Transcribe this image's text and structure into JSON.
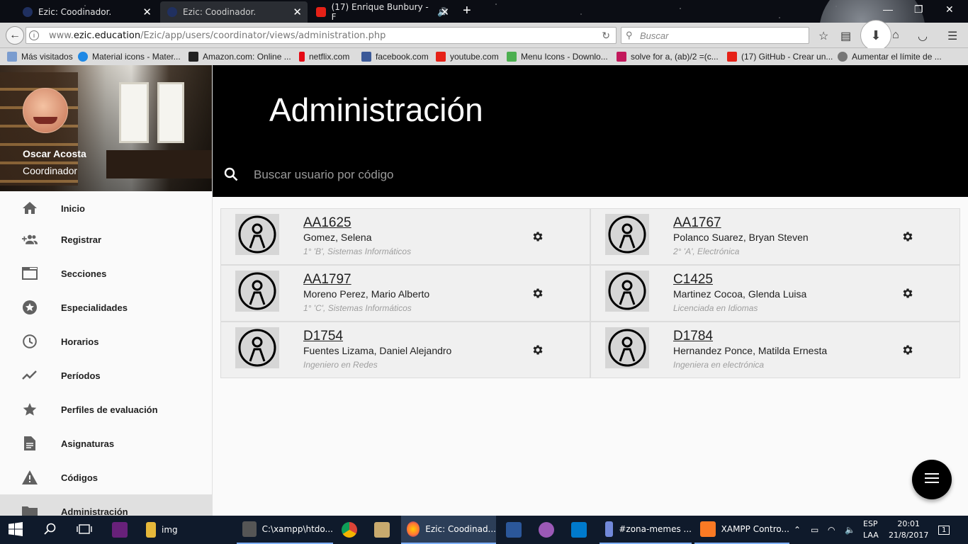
{
  "browser": {
    "tabs": [
      {
        "title": "Ezic: Coodinador.",
        "close": "✕"
      },
      {
        "title": "Ezic: Coodinador.",
        "close": "✕"
      },
      {
        "title": "(17) Enrique Bunbury - F",
        "close": "✕"
      }
    ],
    "url_prefix": "www.",
    "url_domain": "ezic.education",
    "url_path": "/Ezic/app/users/coordinator/views/administration.php",
    "search_placeholder": "Buscar",
    "bookmarks": [
      {
        "label": "Más visitados",
        "color": "#7a9ccf"
      },
      {
        "label": "Material icons - Mater...",
        "color": "#1e88e5"
      },
      {
        "label": "Amazon.com: Online ...",
        "color": "#222222"
      },
      {
        "label": "netflix.com",
        "color": "#e50914"
      },
      {
        "label": "facebook.com",
        "color": "#3b5998"
      },
      {
        "label": "youtube.com",
        "color": "#e62117"
      },
      {
        "label": "Menu Icons - Downlo...",
        "color": "#4caf50"
      },
      {
        "label": "solve for a, (ab)/2 =(c...",
        "color": "#c2185b"
      },
      {
        "label": "(17) GitHub - Crear un...",
        "color": "#e62117"
      },
      {
        "label": "Aumentar el límite de ...",
        "color": "#777777"
      }
    ]
  },
  "profile": {
    "name": "Oscar Acosta",
    "role": "Coordinador"
  },
  "menu": [
    {
      "label": "Inicio",
      "icon": "home-icon"
    },
    {
      "label": "Registrar",
      "icon": "add-group-icon"
    },
    {
      "label": "Secciones",
      "icon": "tab-icon"
    },
    {
      "label": "Especialidades",
      "icon": "stars-icon"
    },
    {
      "label": "Horarios",
      "icon": "clock-icon"
    },
    {
      "label": "Períodos",
      "icon": "trending-icon"
    },
    {
      "label": "Perfiles de evaluación",
      "icon": "star-icon"
    },
    {
      "label": "Asignaturas",
      "icon": "document-icon"
    },
    {
      "label": "Códigos",
      "icon": "warning-icon"
    },
    {
      "label": "Administración",
      "icon": "folder-icon"
    }
  ],
  "header": {
    "title": "Administración",
    "search_placeholder": "Buscar usuario por código"
  },
  "users": [
    {
      "code": "AA1625",
      "name": "Gomez, Selena",
      "detail": "1° 'B', Sistemas Informáticos"
    },
    {
      "code": "AA1767",
      "name": "Polanco Suarez, Bryan Steven",
      "detail": "2° 'A', Electrónica"
    },
    {
      "code": "AA1797",
      "name": "Moreno Perez, Mario Alberto",
      "detail": "1° 'C', Sistemas Informáticos"
    },
    {
      "code": "C1425",
      "name": "Martinez Cocoa, Glenda Luisa",
      "detail": "Licenciada en Idiomas"
    },
    {
      "code": "D1754",
      "name": "Fuentes Lizama, Daniel Alejandro",
      "detail": "Ingeniero en Redes"
    },
    {
      "code": "D1784",
      "name": "Hernandez Ponce, Matilda Ernesta",
      "detail": "Ingeniera en electrónica"
    }
  ],
  "taskbar": {
    "items": [
      {
        "label": "img",
        "color": "#e6b83a"
      },
      {
        "label": "C:\\xampp\\htdo...",
        "color": "#555555"
      },
      {
        "label": "Ezic: Coodinad...",
        "color": "#ff7139"
      },
      {
        "label": "#zona-memes ...",
        "color": "#7289da"
      },
      {
        "label": "XAMPP Contro...",
        "color": "#fb7a24"
      }
    ],
    "lang_line1": "ESP",
    "lang_line2": "LAA",
    "time": "20:01",
    "date": "21/8/2017",
    "notification_count": "1"
  }
}
